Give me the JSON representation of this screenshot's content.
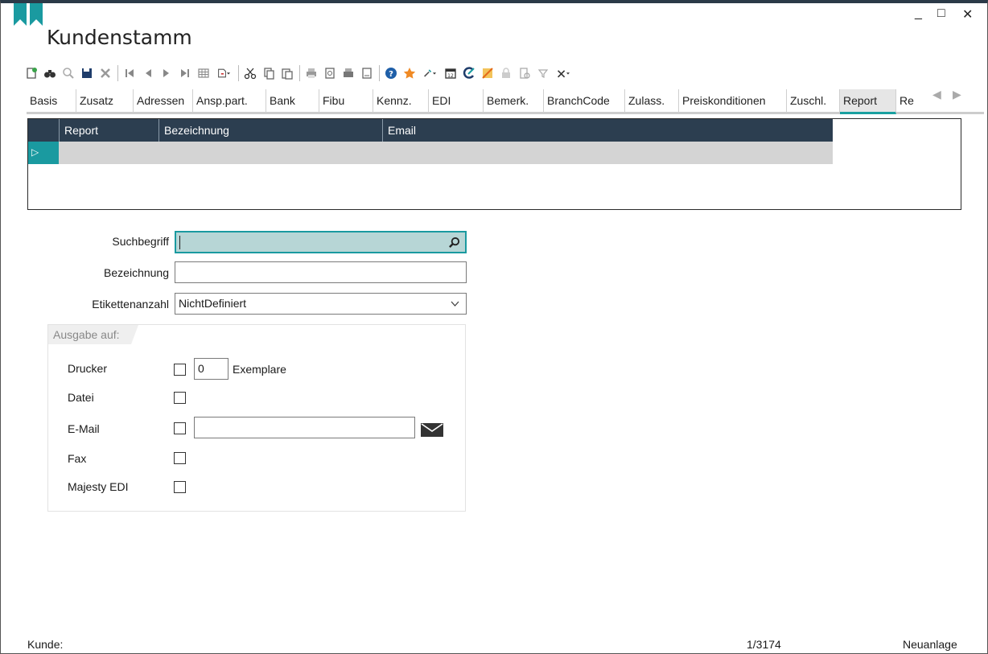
{
  "window": {
    "title": "Kundenstamm",
    "minimize": "_",
    "maximize": "□",
    "close": "✕"
  },
  "toolbar": {
    "icons": [
      "new-record-icon",
      "binoculars-icon",
      "magnifier-icon",
      "save-icon",
      "delete-icon",
      "first-record-icon",
      "previous-record-icon",
      "next-record-icon",
      "last-record-icon",
      "table-view-icon",
      "document-menu-icon",
      "cut-icon",
      "copy-icon",
      "paste-icon",
      "print-icon",
      "print-preview-icon",
      "fax-icon",
      "report-icon",
      "help-icon",
      "favorite-star-icon",
      "tools-menu-icon",
      "calendar-icon",
      "edit-icon",
      "elo-icon",
      "lock-icon",
      "document-gear-icon",
      "filter-icon",
      "settings-menu-icon"
    ]
  },
  "tabs": {
    "items": [
      "Basis",
      "Zusatz",
      "Adressen",
      "Ansp.part.",
      "Bank",
      "Fibu",
      "Kennz.",
      "EDI",
      "Bemerk.",
      "BranchCode",
      "Zulass.",
      "Preiskonditionen",
      "Zuschl.",
      "Report",
      "Re"
    ],
    "active": "Report",
    "prev": "◀",
    "next": "▶"
  },
  "grid": {
    "columns": [
      "Report",
      "Bezeichnung",
      "Email"
    ],
    "row_marker": "▷"
  },
  "form": {
    "suchbegriff_label": "Suchbegriff",
    "suchbegriff_value": "",
    "bezeichnung_label": "Bezeichnung",
    "bezeichnung_value": "",
    "etiketten_label": "Etikettenanzahl",
    "etiketten_value": "NichtDefiniert"
  },
  "output": {
    "header": "Ausgabe auf:",
    "drucker_label": "Drucker",
    "copies_value": "0",
    "exemplare_label": "Exemplare",
    "datei_label": "Datei",
    "email_label": "E-Mail",
    "email_value": "",
    "fax_label": "Fax",
    "edi_label": "Majesty EDI"
  },
  "status": {
    "left": "Kunde:",
    "record": "1/3174",
    "mode": "Neuanlage"
  },
  "colors": {
    "accent": "#1a9aa0",
    "header_dark": "#2c3e50"
  }
}
